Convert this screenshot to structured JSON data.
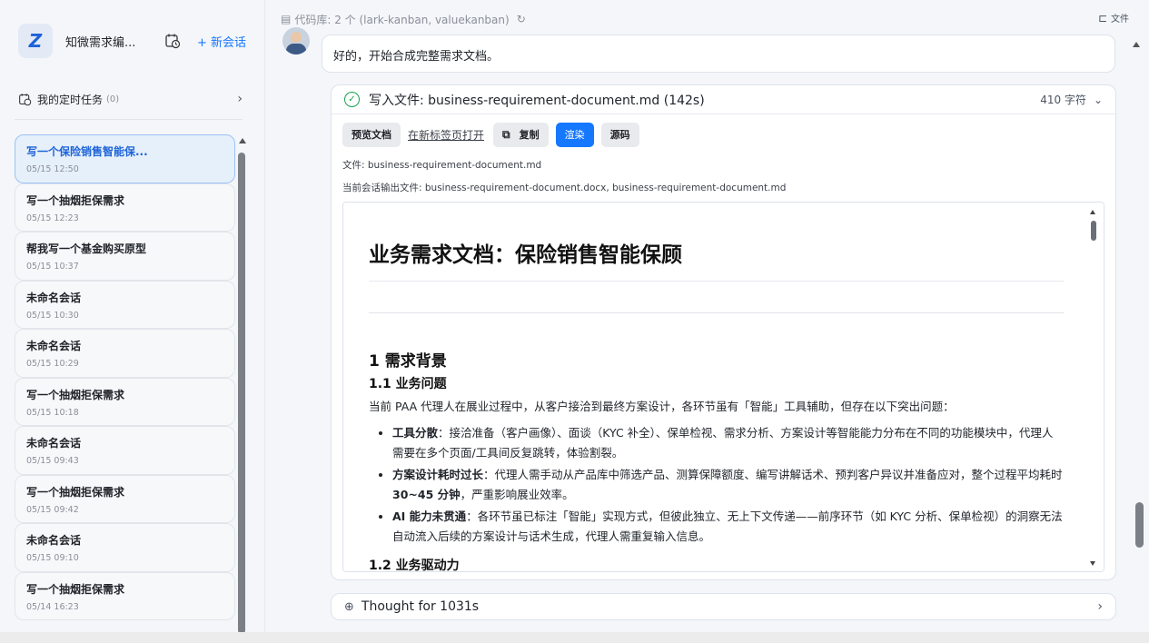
{
  "sidebar": {
    "app_name": "知微需求编...",
    "new_chat_label": "+ 新会话",
    "tasks_label": "我的定时任务",
    "tasks_count": "(0)",
    "sessions": [
      {
        "title": "写一个保险销售智能保...",
        "time": "05/15 12:50",
        "active": true
      },
      {
        "title": "写一个抽烟拒保需求",
        "time": "05/15 12:23"
      },
      {
        "title": "帮我写一个基金购买原型",
        "time": "05/15 10:37"
      },
      {
        "title": "未命名会话",
        "time": "05/15 10:30"
      },
      {
        "title": "未命名会话",
        "time": "05/15 10:29"
      },
      {
        "title": "写一个抽烟拒保需求",
        "time": "05/15 10:18"
      },
      {
        "title": "未命名会话",
        "time": "05/15 09:43"
      },
      {
        "title": "写一个抽烟拒保需求",
        "time": "05/15 09:42"
      },
      {
        "title": "未命名会话",
        "time": "05/15 09:10"
      },
      {
        "title": "写一个抽烟拒保需求",
        "time": "05/14 16:23"
      }
    ]
  },
  "main": {
    "repo_text": "代码库: 2 个 (lark-kanban, valuekanban)",
    "files_label": "文件",
    "message": "好的，开始合成完整需求文档。",
    "tool": {
      "title": "写入文件: business-requirement-document.md (142s)",
      "char_count": "410 字符",
      "buttons": {
        "preview": "预览文档",
        "open_new_tab": "在新标签页打开",
        "copy": "复制",
        "render": "渲染",
        "source": "源码"
      },
      "file_line": "文件: business-requirement-document.md",
      "output_line": "当前会话输出文件: business-requirement-document.docx, business-requirement-document.md"
    },
    "doc": {
      "title": "业务需求文档：保险销售智能保顾",
      "h2_background": "1 需求背景",
      "h3_problem": "1.1 业务问题",
      "intro": "当前 PAA 代理人在展业过程中，从客户接洽到最终方案设计，各环节虽有「智能」工具辅助，但存在以下突出问题：",
      "bullets": [
        {
          "bold": "工具分散",
          "text": "：接洽准备（客户画像）、面谈（KYC 补全）、保单检视、需求分析、方案设计等智能能力分布在不同的功能模块中，代理人需要在多个页面/工具间反复跳转，体验割裂。"
        },
        {
          "bold": "方案设计耗时过长",
          "text": "：代理人需手动从产品库中筛选产品、测算保障额度、编写讲解话术、预判客户异议并准备应对，整个过程平均耗时 ",
          "bold2": "30~45 分钟",
          "text2": "，严重影响展业效率。"
        },
        {
          "bold": "AI 能力未贯通",
          "text": "：各环节虽已标注「智能」实现方式，但彼此独立、无上下文传递——前序环节（如 KYC 分析、保单检视）的洞察无法自动流入后续的方案设计与话术生成，代理人需重复输入信息。"
        }
      ],
      "h3_driver": "1.2 业务驱动力"
    },
    "thought_label": "Thought for 1031s"
  }
}
